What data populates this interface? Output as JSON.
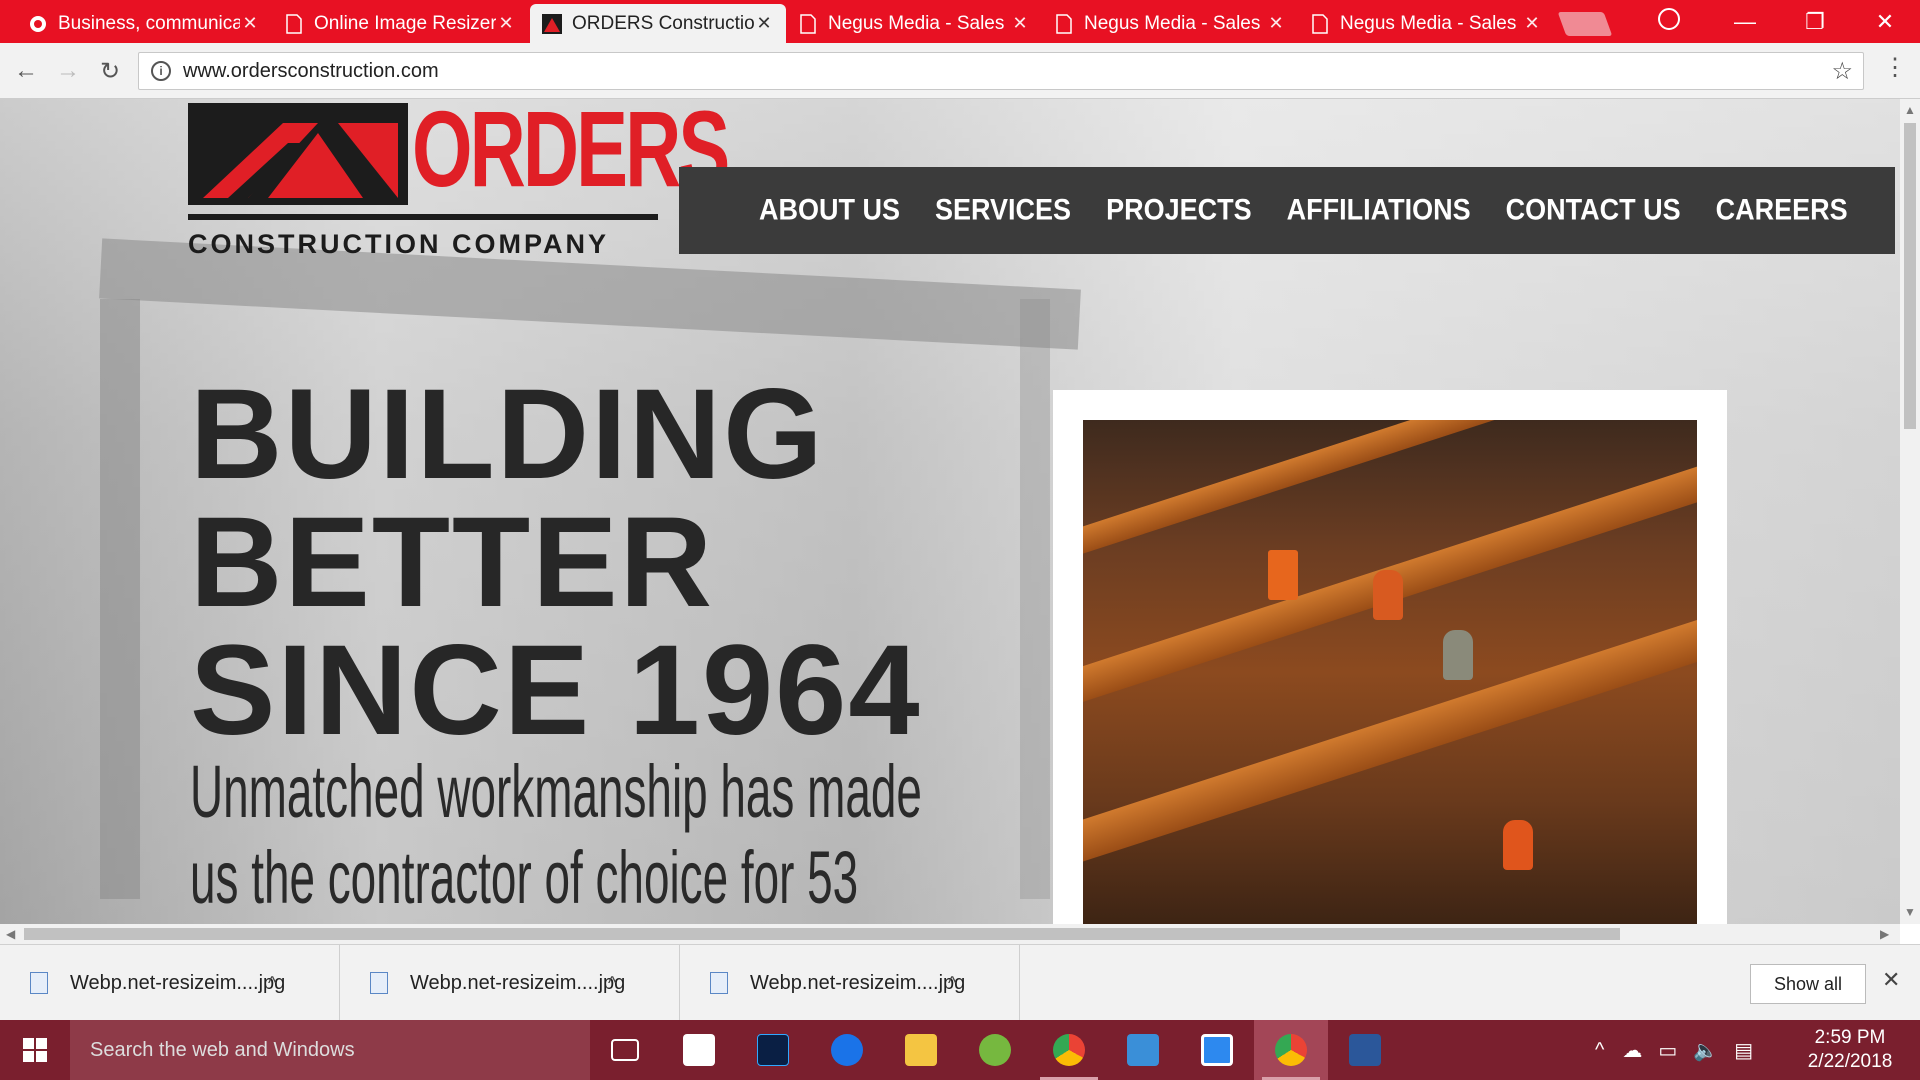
{
  "browser": {
    "tabs": [
      {
        "title": "Business, communica",
        "icon": "app-icon",
        "active": false
      },
      {
        "title": "Online Image Resizer",
        "icon": "page-icon",
        "active": false
      },
      {
        "title": "ORDERS Constructio",
        "icon": "orders-logo-icon",
        "active": true
      },
      {
        "title": "Negus Media - Sales",
        "icon": "page-icon",
        "active": false
      },
      {
        "title": "Negus Media - Sales",
        "icon": "page-icon",
        "active": false
      },
      {
        "title": "Negus Media - Sales",
        "icon": "page-icon",
        "active": false
      }
    ],
    "tab_color": "#e81123",
    "url": "www.ordersconstruction.com"
  },
  "site": {
    "logo": {
      "word": "ORDERS",
      "subtitle": "CONSTRUCTION COMPANY"
    },
    "nav": [
      "ABOUT US",
      "SERVICES",
      "PROJECTS",
      "AFFILIATIONS",
      "CONTACT US",
      "CAREERS"
    ],
    "headline": [
      "BUILDING",
      "BETTER",
      "SINCE 1964"
    ],
    "tagline": [
      "Unmatched workmanship has made",
      "us the contractor of choice for 53"
    ],
    "brand_red": "#e01f26",
    "nav_bg": "#3b3b3b"
  },
  "downloads": {
    "items": [
      "Webp.net-resizeim....jpg",
      "Webp.net-resizeim....jpg",
      "Webp.net-resizeim....jpg"
    ],
    "show_all": "Show all"
  },
  "taskbar": {
    "search_placeholder": "Search the web and Windows",
    "time": "2:59 PM",
    "date": "2/22/2018",
    "apps": [
      "task-view-icon",
      "store-icon",
      "photoshop-icon",
      "edge-icon",
      "file-explorer-icon",
      "utorrent-icon",
      "chrome-icon",
      "mail-icon",
      "app-icon",
      "chrome-icon",
      "word-icon"
    ]
  }
}
